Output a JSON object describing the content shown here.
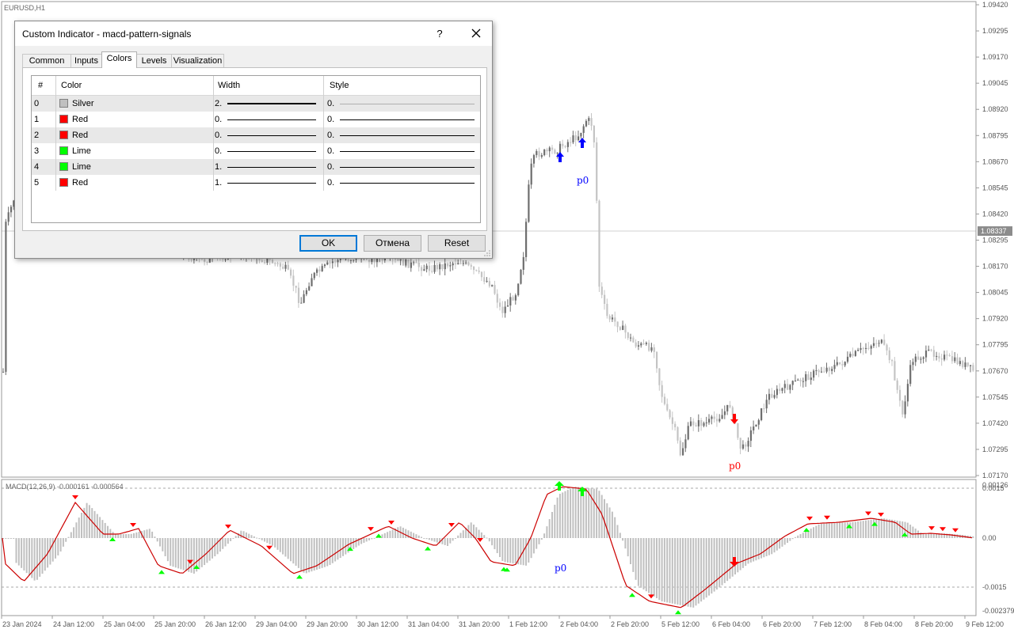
{
  "chart": {
    "symbol": "EURUSD,H1",
    "price_axis": [
      "1.09420",
      "1.09295",
      "1.09170",
      "1.09045",
      "1.08920",
      "1.08795",
      "1.08670",
      "1.08545",
      "1.08420",
      "1.08295",
      "1.08170",
      "1.08045",
      "1.07920",
      "1.07795",
      "1.07670",
      "1.07545",
      "1.07420",
      "1.07295",
      "1.07170"
    ],
    "current_price": "1.08337",
    "macd_label": "MACD(12,26,9) -0.000161 -0.000564",
    "macd_axis": [
      "0.00126",
      "0.0015",
      "0.00",
      "-0.0015",
      "-0.002379"
    ],
    "time_axis": [
      "23 Jan 2024",
      "24 Jan 12:00",
      "25 Jan 04:00",
      "25 Jan 20:00",
      "26 Jan 12:00",
      "29 Jan 04:00",
      "29 Jan 20:00",
      "30 Jan 12:00",
      "31 Jan 04:00",
      "31 Jan 20:00",
      "1 Feb 12:00",
      "2 Feb 04:00",
      "2 Feb 20:00",
      "5 Feb 12:00",
      "6 Feb 04:00",
      "6 Feb 20:00",
      "7 Feb 12:00",
      "8 Feb 04:00",
      "8 Feb 20:00",
      "9 Feb 12:00"
    ],
    "signals": [
      {
        "label": "p0",
        "direction": "up",
        "color": "#0000ff"
      },
      {
        "label": "p0",
        "direction": "up",
        "color": "#0000ff"
      },
      {
        "label": "p0",
        "direction": "down",
        "color": "#ff0000"
      }
    ],
    "macd_arrow_colors": {
      "buy": "#00ff00",
      "sell": "#ff0000"
    }
  },
  "dialog": {
    "title": "Custom Indicator - macd-pattern-signals",
    "help": "?",
    "tabs": [
      "Common",
      "Inputs",
      "Colors",
      "Levels",
      "Visualization"
    ],
    "active_tab": "Colors",
    "columns": {
      "index": "#",
      "color": "Color",
      "width": "Width",
      "style": "Style"
    },
    "rows": [
      {
        "index": "0",
        "color_name": "Silver",
        "color_hex": "#c0c0c0",
        "width": "2.",
        "style": "0."
      },
      {
        "index": "1",
        "color_name": "Red",
        "color_hex": "#ff0000",
        "width": "0.",
        "style": "0."
      },
      {
        "index": "2",
        "color_name": "Red",
        "color_hex": "#ff0000",
        "width": "0.",
        "style": "0."
      },
      {
        "index": "3",
        "color_name": "Lime",
        "color_hex": "#00ff00",
        "width": "0.",
        "style": "0."
      },
      {
        "index": "4",
        "color_name": "Lime",
        "color_hex": "#00ff00",
        "width": "1.",
        "style": "0."
      },
      {
        "index": "5",
        "color_name": "Red",
        "color_hex": "#ff0000",
        "width": "1.",
        "style": "0."
      }
    ],
    "buttons": {
      "ok": "OK",
      "cancel": "Отмена",
      "reset": "Reset"
    }
  }
}
